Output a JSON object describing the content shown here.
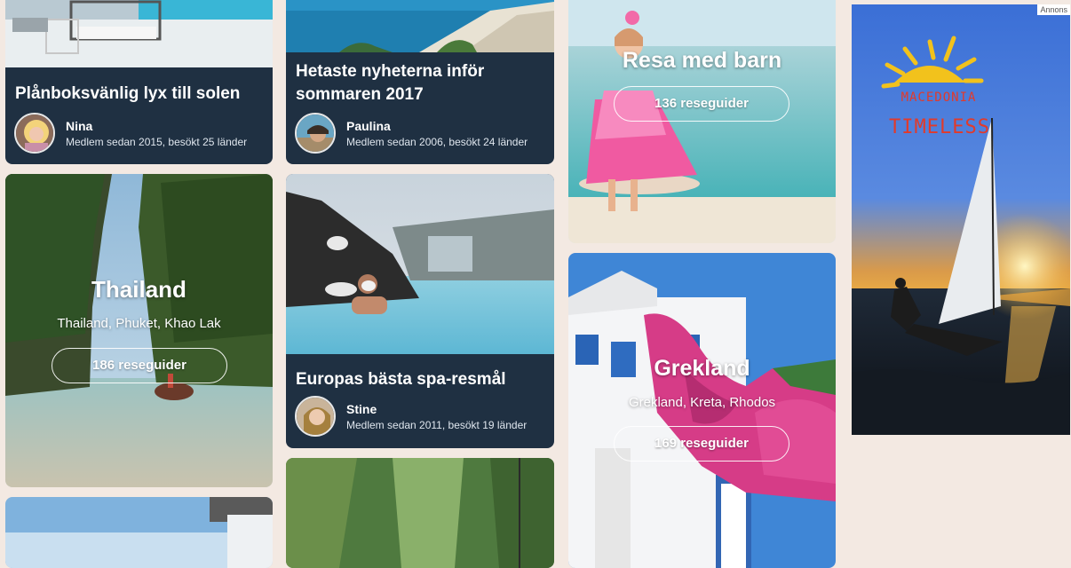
{
  "articles": [
    {
      "title": "Plånboksvänlig lyx till solen",
      "author": "Nina",
      "meta": "Medlem sedan 2015, besökt 25 länder"
    },
    {
      "title": "Hetaste nyheterna inför sommaren 2017",
      "author": "Paulina",
      "meta": "Medlem sedan 2006, besökt 24 länder"
    },
    {
      "title": "Europas bästa spa-resmål",
      "author": "Stine",
      "meta": "Medlem sedan 2011, besökt 19 länder"
    }
  ],
  "destinations": [
    {
      "title": "Thailand",
      "subtitle": "Thailand, Phuket, Khao Lak",
      "button": "186 reseguider"
    },
    {
      "title": "Resa med barn",
      "subtitle": "",
      "button": "136 reseguider"
    },
    {
      "title": "Grekland",
      "subtitle": "Grekland, Kreta, Rhodos",
      "button": "169 reseguider"
    }
  ],
  "ad": {
    "label": "Annons",
    "brand_line1": "MACEDONIA",
    "brand_line2": "TIMELESS"
  },
  "colors": {
    "card_dark": "#1f3042",
    "page_bg": "#f3e9e2"
  }
}
